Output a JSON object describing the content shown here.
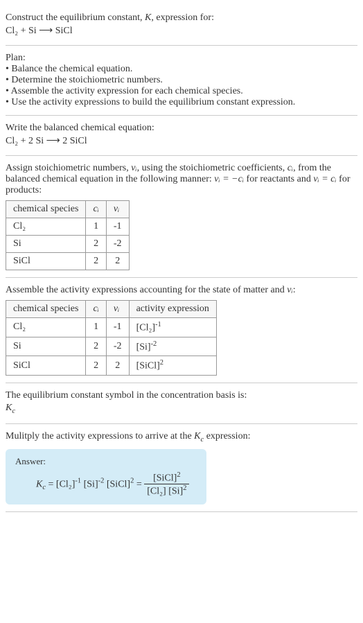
{
  "intro": {
    "line1": "Construct the equilibrium constant, ",
    "k": "K",
    "line1b": ", expression for:",
    "eq": "Cl₂ + Si ⟶ SiCl"
  },
  "plan": {
    "header": "Plan:",
    "b1": "• Balance the chemical equation.",
    "b2": "• Determine the stoichiometric numbers.",
    "b3": "• Assemble the activity expression for each chemical species.",
    "b4": "• Use the activity expressions to build the equilibrium constant expression."
  },
  "balanced": {
    "header": "Write the balanced chemical equation:",
    "eq": "Cl₂ + 2 Si ⟶ 2 SiCl"
  },
  "stoich": {
    "text1": "Assign stoichiometric numbers, ",
    "nui": "νᵢ",
    "text2": ", using the stoichiometric coefficients, ",
    "ci": "cᵢ",
    "text3": ", from the balanced chemical equation in the following manner: ",
    "rel1": "νᵢ = −cᵢ",
    "text4": " for reactants and ",
    "rel2": "νᵢ = cᵢ",
    "text5": " for products:",
    "headers": [
      "chemical species",
      "cᵢ",
      "νᵢ"
    ],
    "rows": [
      {
        "sp": "Cl₂",
        "c": "1",
        "v": "-1"
      },
      {
        "sp": "Si",
        "c": "2",
        "v": "-2"
      },
      {
        "sp": "SiCl",
        "c": "2",
        "v": "2"
      }
    ]
  },
  "activity": {
    "header1": "Assemble the activity expressions accounting for the state of matter and ",
    "nui": "νᵢ",
    "header2": ":",
    "headers": [
      "chemical species",
      "cᵢ",
      "νᵢ",
      "activity expression"
    ],
    "rows": [
      {
        "sp": "Cl₂",
        "c": "1",
        "v": "-1",
        "a_base": "[Cl₂]",
        "a_exp": "-1"
      },
      {
        "sp": "Si",
        "c": "2",
        "v": "-2",
        "a_base": "[Si]",
        "a_exp": "-2"
      },
      {
        "sp": "SiCl",
        "c": "2",
        "v": "2",
        "a_base": "[SiCl]",
        "a_exp": "2"
      }
    ]
  },
  "symbol": {
    "text": "The equilibrium constant symbol in the concentration basis is:",
    "kc": "K",
    "c": "c"
  },
  "multiply": {
    "text1": "Mulitply the activity expressions to arrive at the ",
    "kc": "K",
    "c": "c",
    "text2": " expression:"
  },
  "answer": {
    "label": "Answer:",
    "kc": "K",
    "c": "c",
    "eq": " = ",
    "t1_base": "[Cl₂]",
    "t1_exp": "-1",
    "t2_base": "[Si]",
    "t2_exp": "-2",
    "t3_base": "[SiCl]",
    "t3_exp": "2",
    "eq2": " = ",
    "num_base": "[SiCl]",
    "num_exp": "2",
    "den1": "[Cl₂]",
    "den2_base": "[Si]",
    "den2_exp": "2"
  }
}
